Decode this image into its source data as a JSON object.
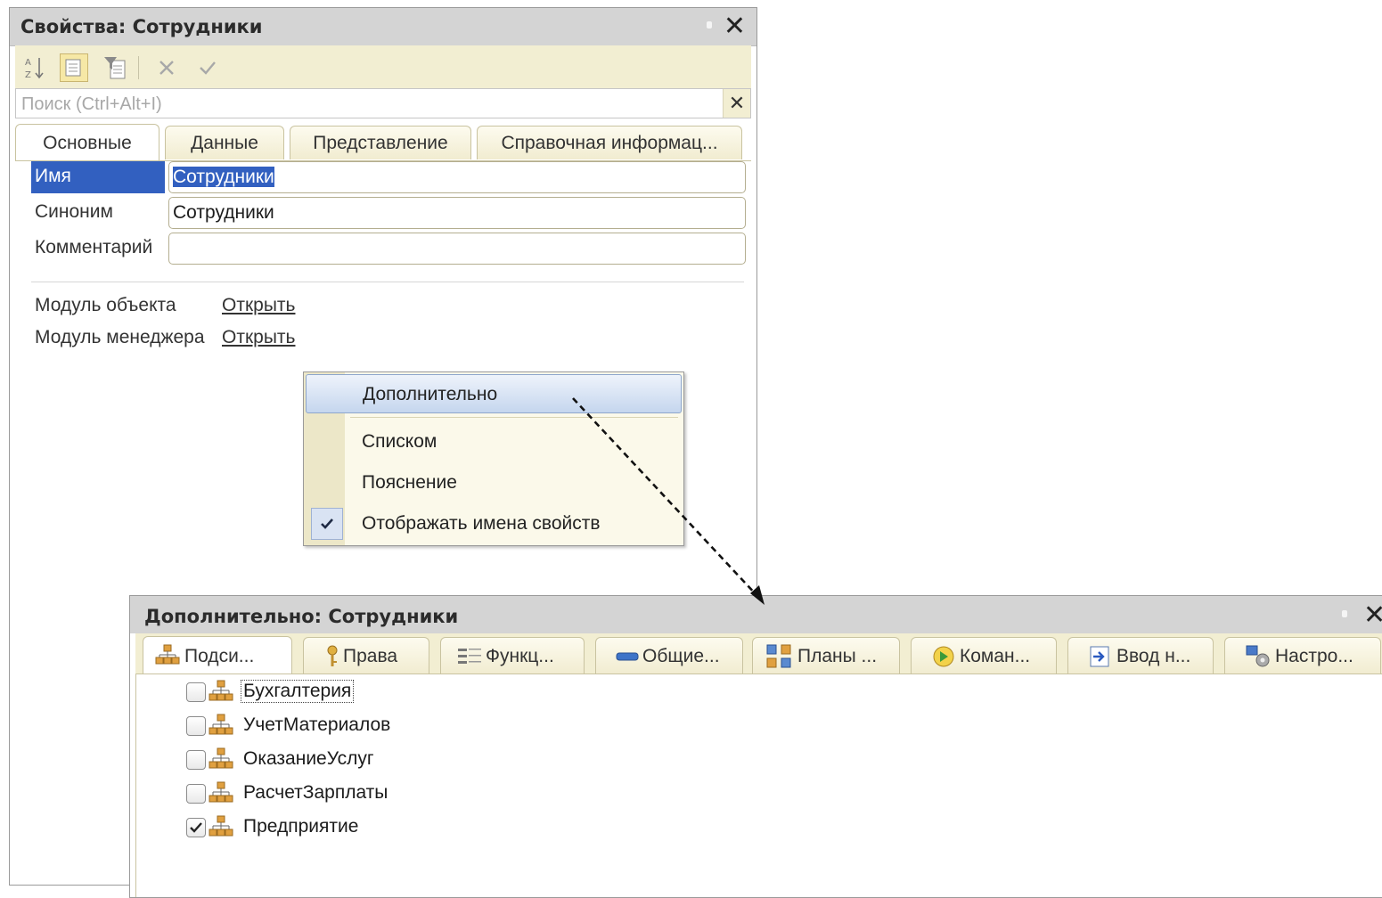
{
  "properties_window": {
    "title": "Свойства: Сотрудники",
    "search": {
      "placeholder": "Поиск (Ctrl+Alt+I)",
      "value": ""
    },
    "tabs": [
      {
        "label": "Основные",
        "active": true
      },
      {
        "label": "Данные",
        "active": false
      },
      {
        "label": "Представление",
        "active": false
      },
      {
        "label": "Справочная информац...",
        "active": false
      }
    ],
    "fields": [
      {
        "label": "Имя",
        "value": "Сотрудники",
        "selected": true
      },
      {
        "label": "Синоним",
        "value": "Сотрудники"
      },
      {
        "label": "Комментарий",
        "value": ""
      }
    ],
    "modules": [
      {
        "label": "Модуль объекта",
        "link": "Открыть"
      },
      {
        "label": "Модуль менеджера",
        "link": "Открыть"
      }
    ]
  },
  "context_menu": {
    "items": [
      {
        "label": "Дополнительно",
        "highlighted": true
      },
      {
        "label": "Списком"
      },
      {
        "label": "Пояснение"
      },
      {
        "label": "Отображать имена свойств",
        "checked": true
      }
    ]
  },
  "additional_window": {
    "title": "Дополнительно: Сотрудники",
    "tabs": [
      {
        "label": "Подси...",
        "icon": "subsystem-icon",
        "active": true
      },
      {
        "label": "Права",
        "icon": "key-icon"
      },
      {
        "label": "Функц...",
        "icon": "functional-options-icon"
      },
      {
        "label": "Общие...",
        "icon": "common-attributes-icon"
      },
      {
        "label": "Планы ...",
        "icon": "exchange-plans-icon"
      },
      {
        "label": "Коман...",
        "icon": "commands-icon"
      },
      {
        "label": "Ввод н...",
        "icon": "input-based-icon"
      },
      {
        "label": "Настро...",
        "icon": "settings-icon"
      }
    ],
    "subsystems": [
      {
        "label": "Бухгалтерия",
        "checked": false,
        "focused": true
      },
      {
        "label": "УчетМатериалов",
        "checked": false
      },
      {
        "label": "ОказаниеУслуг",
        "checked": false
      },
      {
        "label": "РасчетЗарплаты",
        "checked": false
      },
      {
        "label": "Предприятие",
        "checked": true
      }
    ]
  },
  "colors": {
    "selection": "#3260c0",
    "toolbar_bg": "#f2eed2",
    "title_bg": "#d4d4d4",
    "menu_highlight": "#c5d6ee"
  }
}
